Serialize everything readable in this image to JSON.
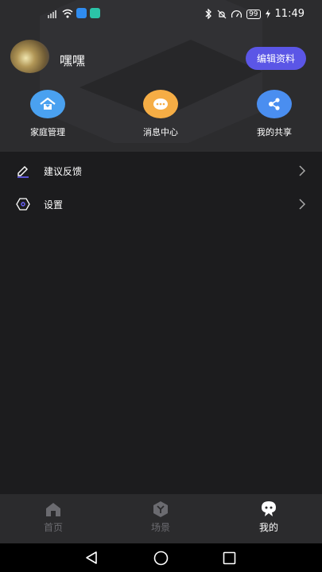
{
  "status_bar": {
    "time": "11:49",
    "battery": "99"
  },
  "profile": {
    "username": "嘿嘿",
    "edit_label": "编辑资料"
  },
  "quick_actions": [
    {
      "label": "家庭管理",
      "icon": "home-icon",
      "color": "#4aa1f0"
    },
    {
      "label": "消息中心",
      "icon": "chat-icon",
      "color": "#f5ad45"
    },
    {
      "label": "我的共享",
      "icon": "share-icon",
      "color": "#4a8ef0"
    }
  ],
  "menu": [
    {
      "label": "建议反馈",
      "icon": "pencil-icon"
    },
    {
      "label": "设置",
      "icon": "settings-icon"
    }
  ],
  "tabs": [
    {
      "label": "首页",
      "icon": "home-tab-icon",
      "active": false
    },
    {
      "label": "场景",
      "icon": "scene-icon",
      "active": false
    },
    {
      "label": "我的",
      "icon": "profile-tab-icon",
      "active": true
    }
  ],
  "colors": {
    "accent": "#5b56e6",
    "background": "#1c1c1e",
    "header": "#2c2c2e"
  }
}
